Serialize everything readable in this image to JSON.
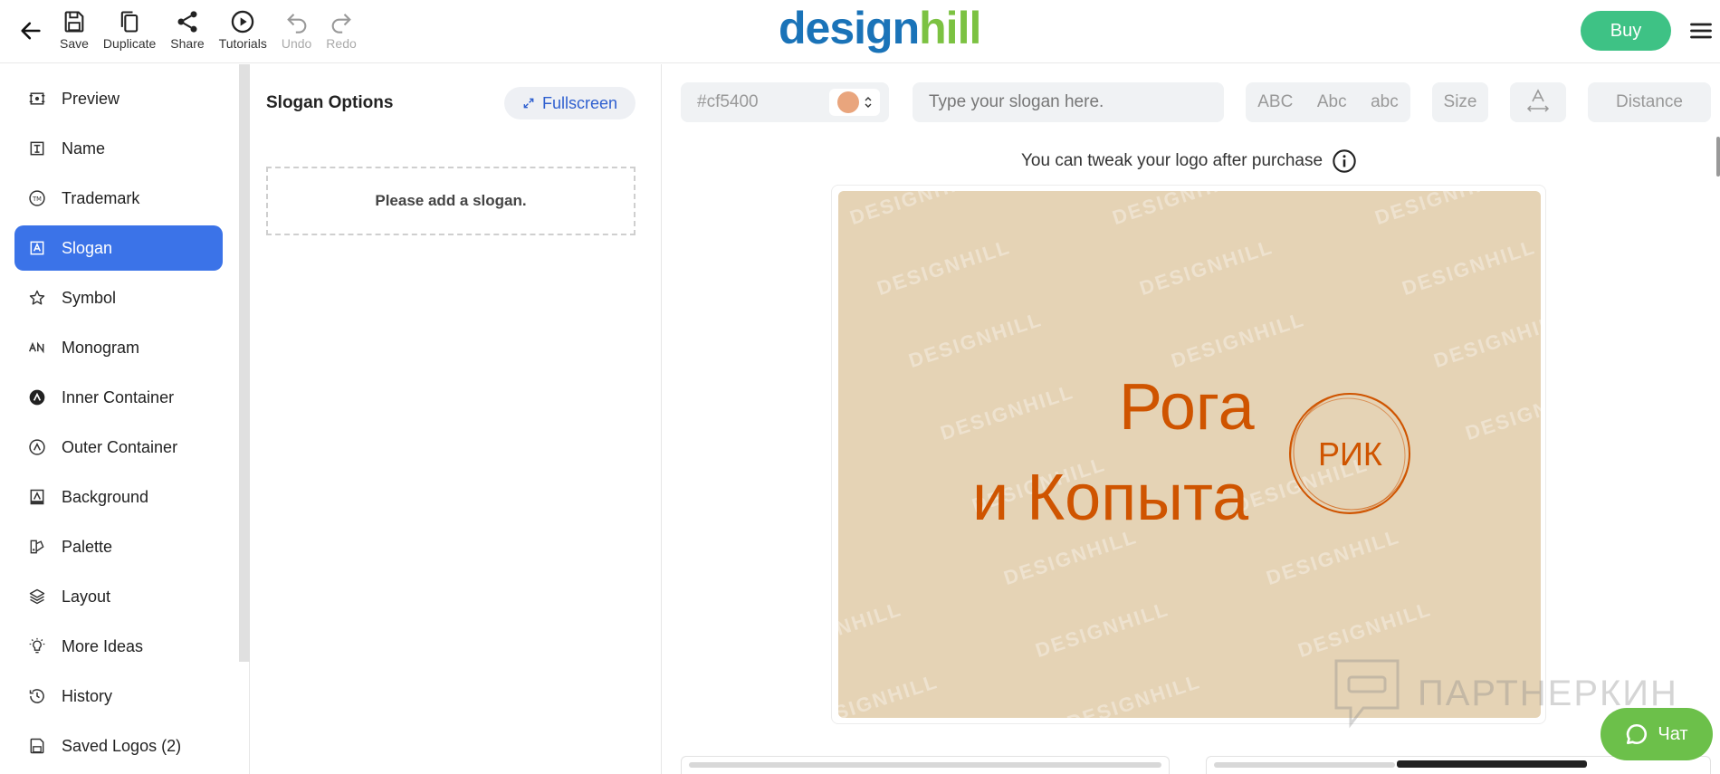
{
  "toolbar": {
    "save": "Save",
    "duplicate": "Duplicate",
    "share": "Share",
    "tutorials": "Tutorials",
    "undo": "Undo",
    "redo": "Redo"
  },
  "brand": {
    "logo_part1": "design",
    "logo_part2": "hill"
  },
  "header": {
    "buy_label": "Buy"
  },
  "sidebar": {
    "items": [
      {
        "label": "Preview",
        "icon": "preview-icon"
      },
      {
        "label": "Name",
        "icon": "name-icon"
      },
      {
        "label": "Trademark",
        "icon": "trademark-icon"
      },
      {
        "label": "Slogan",
        "icon": "slogan-icon",
        "active": true
      },
      {
        "label": "Symbol",
        "icon": "star-icon"
      },
      {
        "label": "Monogram",
        "icon": "monogram-icon"
      },
      {
        "label": "Inner Container",
        "icon": "inner-container-icon"
      },
      {
        "label": "Outer Container",
        "icon": "outer-container-icon"
      },
      {
        "label": "Background",
        "icon": "background-icon"
      },
      {
        "label": "Palette",
        "icon": "palette-icon"
      },
      {
        "label": "Layout",
        "icon": "layers-icon"
      },
      {
        "label": "More Ideas",
        "icon": "lightbulb-icon"
      },
      {
        "label": "History",
        "icon": "history-icon"
      },
      {
        "label": "Saved Logos (2)",
        "icon": "saved-icon"
      }
    ]
  },
  "options": {
    "title": "Slogan Options",
    "fullscreen_label": "Fullscreen",
    "empty_message": "Please add a slogan."
  },
  "editor": {
    "color_value": "#cf5400",
    "swatch_color": "#e9a57d",
    "slogan_placeholder": "Type your slogan here.",
    "case_upper": "ABC",
    "case_title": "Abc",
    "case_lower": "abc",
    "size_label": "Size",
    "distance_label": "Distance",
    "tweak_note": "You can tweak your logo after purchase"
  },
  "logo_preview": {
    "line1": "Рога",
    "line2": "и Копыта",
    "monogram": "РИК",
    "text_color": "#cf5400",
    "background_color": "#e5d3b5",
    "watermark": "DESIGNHILL"
  },
  "overlay": {
    "partner_watermark": "ПАРТНЕРКИН"
  },
  "chat": {
    "label": "Чат"
  }
}
